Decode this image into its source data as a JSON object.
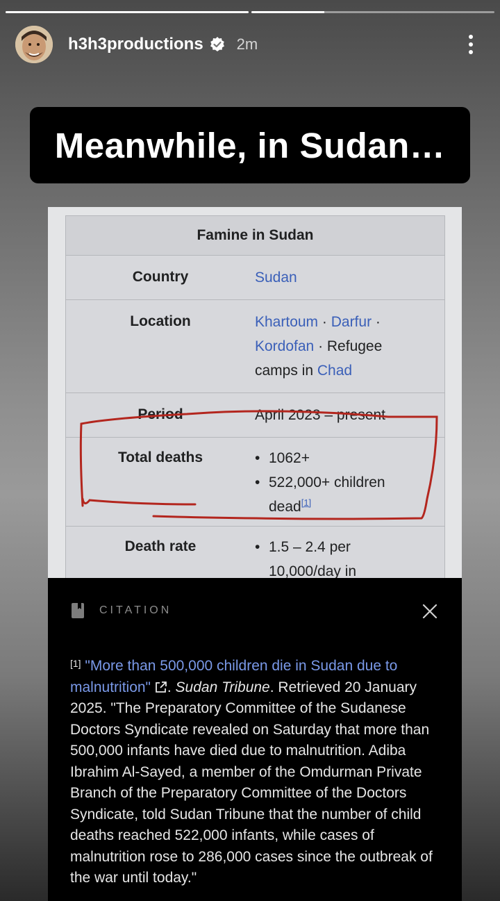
{
  "story": {
    "progress": [
      1.0,
      0.3
    ],
    "username": "h3h3productions",
    "time": "2m"
  },
  "caption": "Meanwhile, in Sudan…",
  "infobox": {
    "title": "Famine in Sudan",
    "country_label": "Country",
    "country_value": "Sudan",
    "location_label": "Location",
    "location_parts": [
      "Khartoum",
      " · ",
      "Darfur",
      " ·",
      "Kordofan",
      " · Refugee",
      "camps in ",
      "Chad"
    ],
    "period_label": "Period",
    "period_value": "April 2023 – present",
    "deaths_label": "Total deaths",
    "deaths_items": [
      "1062+",
      "522,000+ children",
      "dead"
    ],
    "deaths_ref": "[1]",
    "rate_label": "Death rate",
    "rate_items": [
      "1.5 – 2.4 per",
      "10,000/day in"
    ]
  },
  "citation": {
    "header": "CITATION",
    "ref_num": "[1]",
    "link_text": "\"More than 500,000 children die in Sudan due to malnutrition\"",
    "source": "Sudan Tribune",
    "text_after_source": ". Retrieved 20 January 2025. \"The Preparatory Committee of the Sudanese Doctors Syndicate revealed on Saturday that more than 500,000 infants have died due to malnutrition. Adiba Ibrahim Al-Sayed, a member of the Omdurman Private Branch of the Preparatory Committee of the Doctors Syndicate, told Sudan Tribune that the number of child deaths reached 522,000 infants, while cases of malnutrition rose to 286,000 cases since the outbreak of the war until today.\""
  }
}
